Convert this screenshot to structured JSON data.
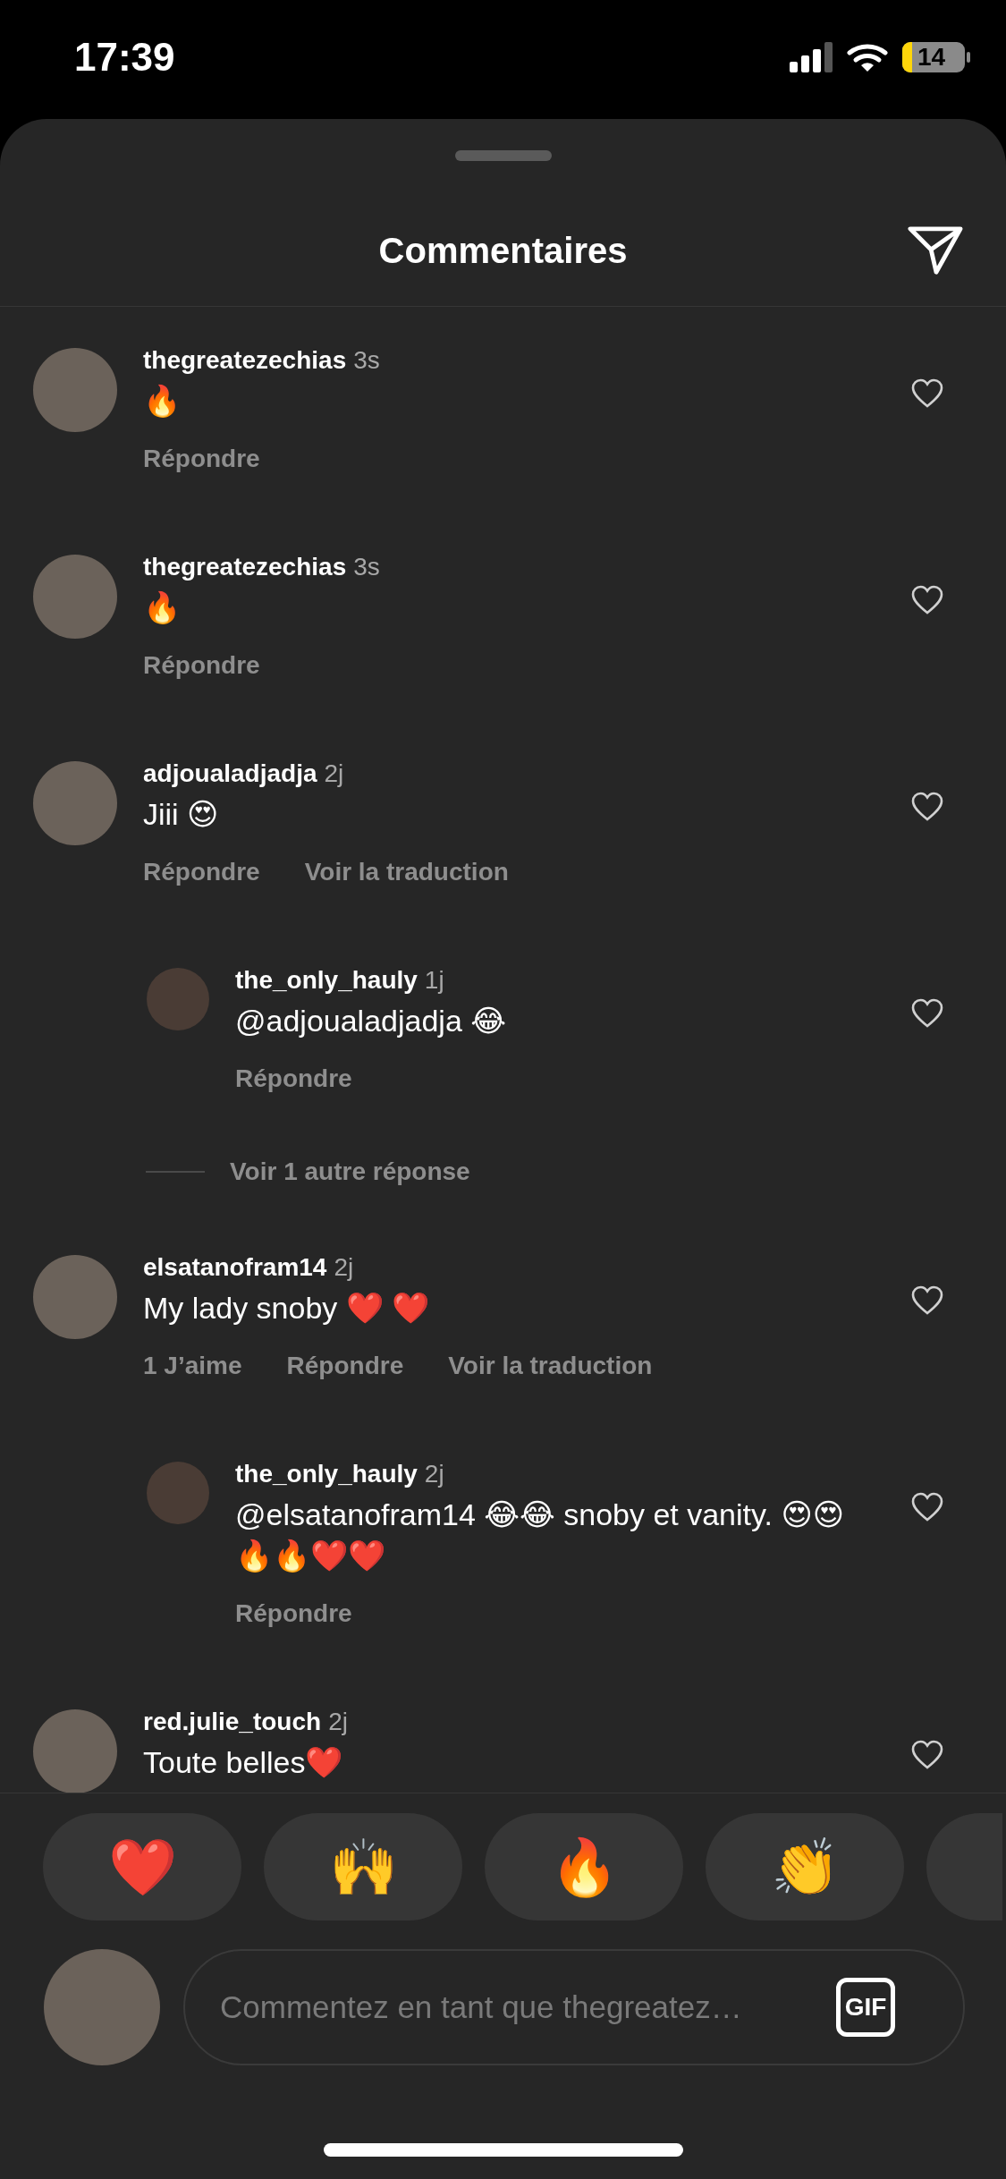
{
  "status_bar": {
    "time": "17:39",
    "battery": "14"
  },
  "header": {
    "title": "Commentaires"
  },
  "comments": [
    {
      "username": "thegreatezechias",
      "time": "3s",
      "text": "🔥",
      "actions": [
        "Répondre"
      ],
      "liked": false
    },
    {
      "username": "thegreatezechias",
      "time": "3s",
      "text": "🔥",
      "actions": [
        "Répondre"
      ],
      "liked": false
    },
    {
      "username": "adjoualadjadja",
      "time": "2j",
      "text": "Jiii 😍",
      "actions": [
        "Répondre",
        "Voir la traduction"
      ],
      "liked": false,
      "replies": [
        {
          "username": "the_only_hauly",
          "time": "1j",
          "text": "@adjoualadjadja 😂",
          "actions": [
            "Répondre"
          ],
          "liked": false
        }
      ],
      "more_replies": "Voir 1 autre réponse"
    },
    {
      "username": "elsatanofram14",
      "time": "2j",
      "text": "My lady snoby ❤️ ❤️",
      "actions": [
        "1 J’aime",
        "Répondre",
        "Voir la traduction"
      ],
      "liked": false,
      "replies": [
        {
          "username": "the_only_hauly",
          "time": "2j",
          "text": "@elsatanofram14 😂😂 snoby et vanity. 😍😍🔥🔥❤️❤️",
          "actions": [
            "Répondre"
          ],
          "liked": false
        }
      ]
    },
    {
      "username": "red.julie_touch",
      "time": "2j",
      "text": "Toute belles❤️",
      "liked": false
    }
  ],
  "reactions": [
    "❤️",
    "🙌",
    "🔥",
    "👏"
  ],
  "reactions_continue": true,
  "composer": {
    "placeholder": "Commentez en tant que thegreatez…",
    "gif_label": "GIF"
  }
}
